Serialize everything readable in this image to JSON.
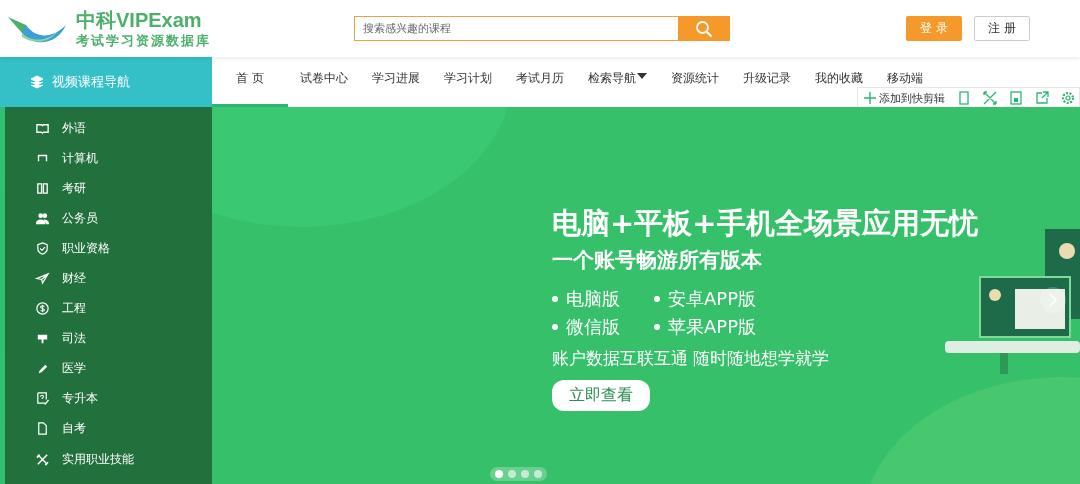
{
  "logo": {
    "title": "中科VIPExam",
    "subtitle": "考试学习资源数据库"
  },
  "search": {
    "placeholder": "搜索感兴趣的课程"
  },
  "auth_buttons": [
    {
      "label": "登 录",
      "kind": "primary"
    },
    {
      "label": "注 册",
      "kind": "outline"
    }
  ],
  "sidebar": {
    "title": "视频课程导航",
    "items": [
      {
        "label": "外语"
      },
      {
        "label": "计算机"
      },
      {
        "label": "考研"
      },
      {
        "label": "公务员"
      },
      {
        "label": "职业资格"
      },
      {
        "label": "财经"
      },
      {
        "label": "工程"
      },
      {
        "label": "司法"
      },
      {
        "label": "医学"
      },
      {
        "label": "专升本"
      },
      {
        "label": "自考"
      },
      {
        "label": "实用职业技能"
      }
    ]
  },
  "nav_tabs": [
    {
      "label": "首 页",
      "selected": true,
      "dropdown": false
    },
    {
      "label": "试卷中心",
      "selected": false,
      "dropdown": false
    },
    {
      "label": "学习进展",
      "selected": false,
      "dropdown": false
    },
    {
      "label": "学习计划",
      "selected": false,
      "dropdown": false
    },
    {
      "label": "考试月历",
      "selected": false,
      "dropdown": false
    },
    {
      "label": "检索导航",
      "selected": false,
      "dropdown": true
    },
    {
      "label": "资源统计",
      "selected": false,
      "dropdown": false
    },
    {
      "label": "升级记录",
      "selected": false,
      "dropdown": false
    },
    {
      "label": "我的收藏",
      "selected": false,
      "dropdown": false
    },
    {
      "label": "移动端",
      "selected": false,
      "dropdown": false
    }
  ],
  "clip_toolbar": {
    "label": "添加到快剪辑"
  },
  "banner": {
    "headline": "电脑+平板+手机全场景应用无忧",
    "subheadline": "一个账号畅游所有版本",
    "versions": [
      "电脑版",
      "安卓APP版",
      "微信版",
      "苹果APP版"
    ],
    "tagline": "账户数据互联互通 随时随地想学就学",
    "cta": "立即查看",
    "dots": [
      {
        "selected": true
      },
      {
        "selected": false
      },
      {
        "selected": false
      },
      {
        "selected": false
      }
    ]
  }
}
